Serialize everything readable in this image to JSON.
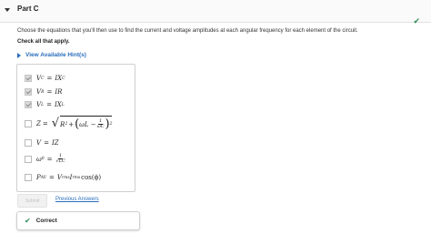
{
  "header": {
    "title": "Part C",
    "complete_icon": "checkmark-icon"
  },
  "question": {
    "prompt": "Choose the equations that you'll then use to find the current and voltage amplitudes at each angular frequency for each element of the circuit.",
    "instruction": "Check all that apply.",
    "hints_label": "View Available Hint(s)"
  },
  "options": [
    {
      "lhs": "V",
      "lhs_sub": "C",
      "rhs": "IX",
      "rhs_sub": "C",
      "checked": true
    },
    {
      "lhs": "V",
      "lhs_sub": "R",
      "rhs": "IR",
      "checked": true
    },
    {
      "lhs": "V",
      "lhs_sub": "L",
      "rhs": "IX",
      "rhs_sub": "L",
      "checked": true
    },
    {
      "lhs": "Z",
      "rhs_a": "R",
      "rhs_b": "2",
      "rhs_c": "+",
      "rhs_d": "ωL −",
      "frac_num": "1",
      "frac_den": "ωC",
      "rhs_e": "2",
      "checked": false
    },
    {
      "lhs": "V",
      "rhs": "IZ",
      "checked": false
    },
    {
      "lhs": "ω",
      "lhs_sub": "0",
      "frac_num": "1",
      "frac_den": "LC",
      "checked": false
    },
    {
      "lhs": "P",
      "lhs_sub": "AV",
      "rhs": "V",
      "rhs_sub": "rms",
      "rhs_2": "I",
      "rhs_2_sub": "rms",
      "rhs_3": "cos(ϕ)",
      "checked": false
    }
  ],
  "actions": {
    "submit_label": "Submit",
    "previous_answers_label": "Previous Answers"
  },
  "feedback": {
    "status": "Correct"
  }
}
